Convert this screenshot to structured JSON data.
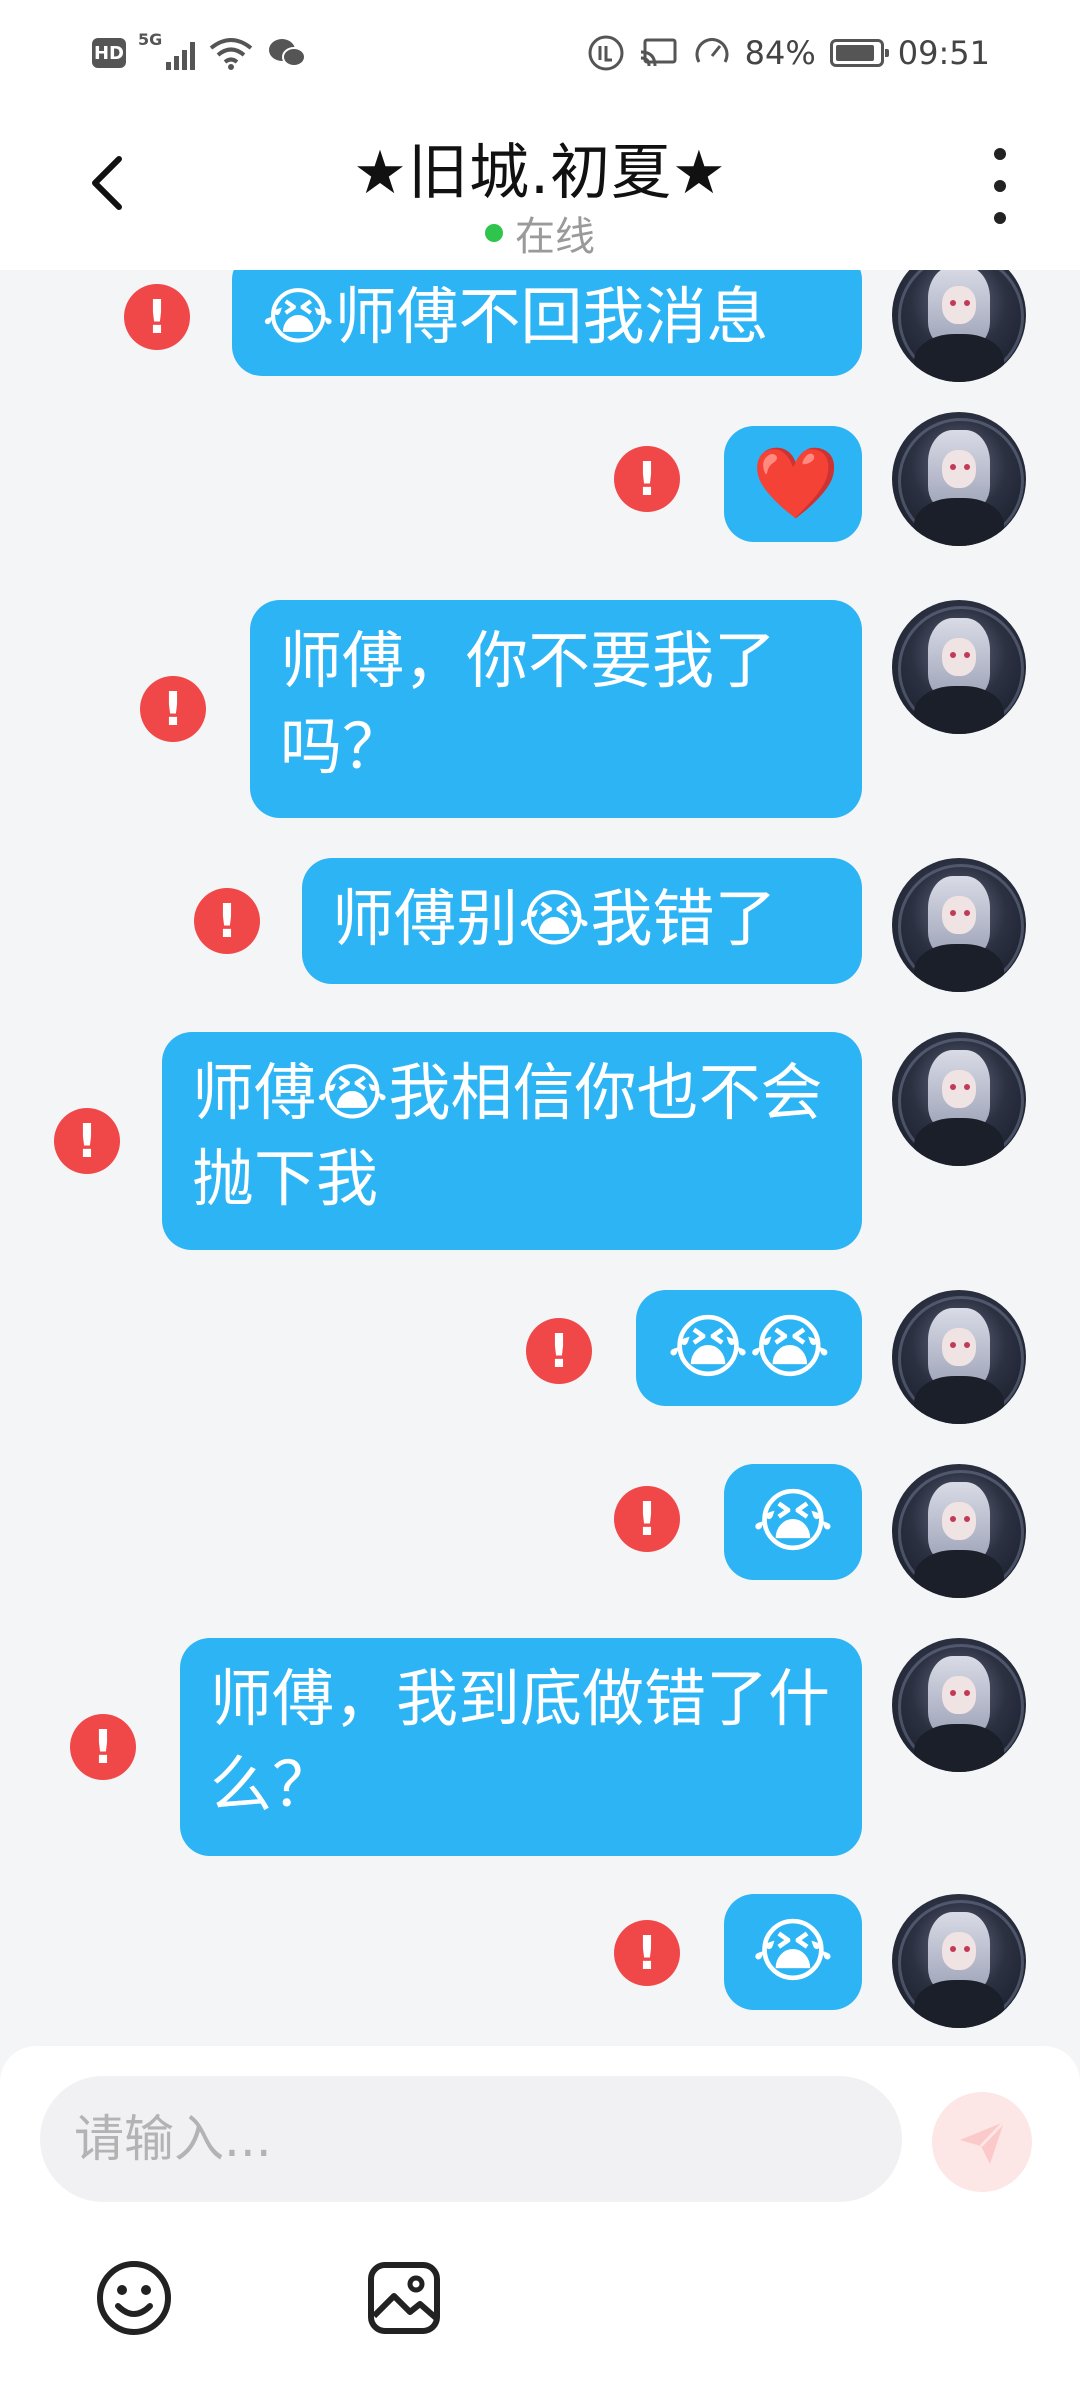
{
  "status_bar": {
    "left": {
      "hd_label": "HD",
      "network_label": "5G"
    },
    "right": {
      "battery_text": "84%",
      "time": "09:51"
    }
  },
  "header": {
    "title": "★旧城.初夏★",
    "status": "在线",
    "status_color": "#2fc54d"
  },
  "messages": [
    {
      "type": "text",
      "text": "😭师傅不回我消息",
      "status": "failed"
    },
    {
      "type": "emoji",
      "text": "❤️",
      "status": "failed"
    },
    {
      "type": "text",
      "text": "师傅，你不要我了吗？",
      "status": "failed"
    },
    {
      "type": "text",
      "text": "师傅别😭我错了",
      "status": "failed"
    },
    {
      "type": "text",
      "text": "师傅😭我相信你也不会抛下我",
      "status": "failed"
    },
    {
      "type": "emoji",
      "text": "😭😭",
      "status": "failed"
    },
    {
      "type": "emoji",
      "text": "😭",
      "status": "failed"
    },
    {
      "type": "text",
      "text": "师傅，我到底做错了什么？",
      "status": "failed"
    },
    {
      "type": "emoji",
      "text": "😭",
      "status": "failed"
    }
  ],
  "error_mark": "!",
  "input": {
    "placeholder": "请输入..."
  },
  "colors": {
    "bubble": "#2cb4f5",
    "error": "#f04848",
    "send_button": "#fde6e6"
  },
  "icons": {
    "back": "chevron-left-icon",
    "more": "more-vertical-icon",
    "send": "paper-plane-icon",
    "emoji": "smiley-icon",
    "image": "image-icon"
  }
}
